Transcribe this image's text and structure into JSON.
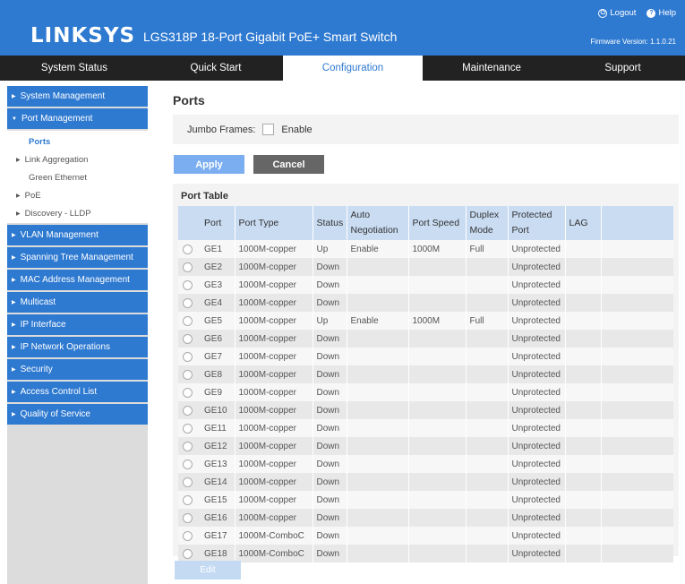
{
  "header": {
    "logo_text": "LINKSYS",
    "product_title": "LGS318P 18-Port Gigabit PoE+ Smart Switch",
    "logout_label": "Logout",
    "help_label": "Help",
    "firmware_text": "Firmware Version: 1.1.0.21",
    "brand_color": "#2f7ad1"
  },
  "nav": {
    "tabs": [
      {
        "label": "System Status"
      },
      {
        "label": "Quick Start"
      },
      {
        "label": "Configuration"
      },
      {
        "label": "Maintenance"
      },
      {
        "label": "Support"
      }
    ],
    "active": "Configuration"
  },
  "sidebar": {
    "items": [
      {
        "label": "System Management"
      },
      {
        "label": "Port Management"
      },
      {
        "label": "VLAN Management"
      },
      {
        "label": "Spanning Tree Management"
      },
      {
        "label": "MAC Address Management"
      },
      {
        "label": "Multicast"
      },
      {
        "label": "IP Interface"
      },
      {
        "label": "IP Network Operations"
      },
      {
        "label": "Security"
      },
      {
        "label": "Access Control List"
      },
      {
        "label": "Quality of Service"
      }
    ],
    "port_sub_items": [
      {
        "label": "Ports"
      },
      {
        "label": "Link Aggregation"
      },
      {
        "label": "Green Ethernet"
      },
      {
        "label": "PoE"
      },
      {
        "label": "Discovery - LLDP"
      }
    ]
  },
  "main": {
    "title": "Ports",
    "jumbo_label": "Jumbo Frames:",
    "enable_label": "Enable",
    "apply_label": "Apply",
    "cancel_label": "Cancel",
    "edit_label": "Edit",
    "table_caption": "Port Table",
    "columns": [
      "Port",
      "Port Type",
      "Status",
      "Auto Negotiation",
      "Port Speed",
      "Duplex Mode",
      "Protected Port",
      "LAG"
    ],
    "rows": [
      {
        "port": "GE1",
        "type": "1000M-copper",
        "status": "Up",
        "auto": "Enable",
        "speed": "1000M",
        "duplex": "Full",
        "protected": "Unprotected",
        "lag": ""
      },
      {
        "port": "GE2",
        "type": "1000M-copper",
        "status": "Down",
        "auto": "",
        "speed": "",
        "duplex": "",
        "protected": "Unprotected",
        "lag": ""
      },
      {
        "port": "GE3",
        "type": "1000M-copper",
        "status": "Down",
        "auto": "",
        "speed": "",
        "duplex": "",
        "protected": "Unprotected",
        "lag": ""
      },
      {
        "port": "GE4",
        "type": "1000M-copper",
        "status": "Down",
        "auto": "",
        "speed": "",
        "duplex": "",
        "protected": "Unprotected",
        "lag": ""
      },
      {
        "port": "GE5",
        "type": "1000M-copper",
        "status": "Up",
        "auto": "Enable",
        "speed": "1000M",
        "duplex": "Full",
        "protected": "Unprotected",
        "lag": ""
      },
      {
        "port": "GE6",
        "type": "1000M-copper",
        "status": "Down",
        "auto": "",
        "speed": "",
        "duplex": "",
        "protected": "Unprotected",
        "lag": ""
      },
      {
        "port": "GE7",
        "type": "1000M-copper",
        "status": "Down",
        "auto": "",
        "speed": "",
        "duplex": "",
        "protected": "Unprotected",
        "lag": ""
      },
      {
        "port": "GE8",
        "type": "1000M-copper",
        "status": "Down",
        "auto": "",
        "speed": "",
        "duplex": "",
        "protected": "Unprotected",
        "lag": ""
      },
      {
        "port": "GE9",
        "type": "1000M-copper",
        "status": "Down",
        "auto": "",
        "speed": "",
        "duplex": "",
        "protected": "Unprotected",
        "lag": ""
      },
      {
        "port": "GE10",
        "type": "1000M-copper",
        "status": "Down",
        "auto": "",
        "speed": "",
        "duplex": "",
        "protected": "Unprotected",
        "lag": ""
      },
      {
        "port": "GE11",
        "type": "1000M-copper",
        "status": "Down",
        "auto": "",
        "speed": "",
        "duplex": "",
        "protected": "Unprotected",
        "lag": ""
      },
      {
        "port": "GE12",
        "type": "1000M-copper",
        "status": "Down",
        "auto": "",
        "speed": "",
        "duplex": "",
        "protected": "Unprotected",
        "lag": ""
      },
      {
        "port": "GE13",
        "type": "1000M-copper",
        "status": "Down",
        "auto": "",
        "speed": "",
        "duplex": "",
        "protected": "Unprotected",
        "lag": ""
      },
      {
        "port": "GE14",
        "type": "1000M-copper",
        "status": "Down",
        "auto": "",
        "speed": "",
        "duplex": "",
        "protected": "Unprotected",
        "lag": ""
      },
      {
        "port": "GE15",
        "type": "1000M-copper",
        "status": "Down",
        "auto": "",
        "speed": "",
        "duplex": "",
        "protected": "Unprotected",
        "lag": ""
      },
      {
        "port": "GE16",
        "type": "1000M-copper",
        "status": "Down",
        "auto": "",
        "speed": "",
        "duplex": "",
        "protected": "Unprotected",
        "lag": ""
      },
      {
        "port": "GE17",
        "type": "1000M-ComboC",
        "status": "Down",
        "auto": "",
        "speed": "",
        "duplex": "",
        "protected": "Unprotected",
        "lag": ""
      },
      {
        "port": "GE18",
        "type": "1000M-ComboC",
        "status": "Down",
        "auto": "",
        "speed": "",
        "duplex": "",
        "protected": "Unprotected",
        "lag": ""
      }
    ]
  }
}
